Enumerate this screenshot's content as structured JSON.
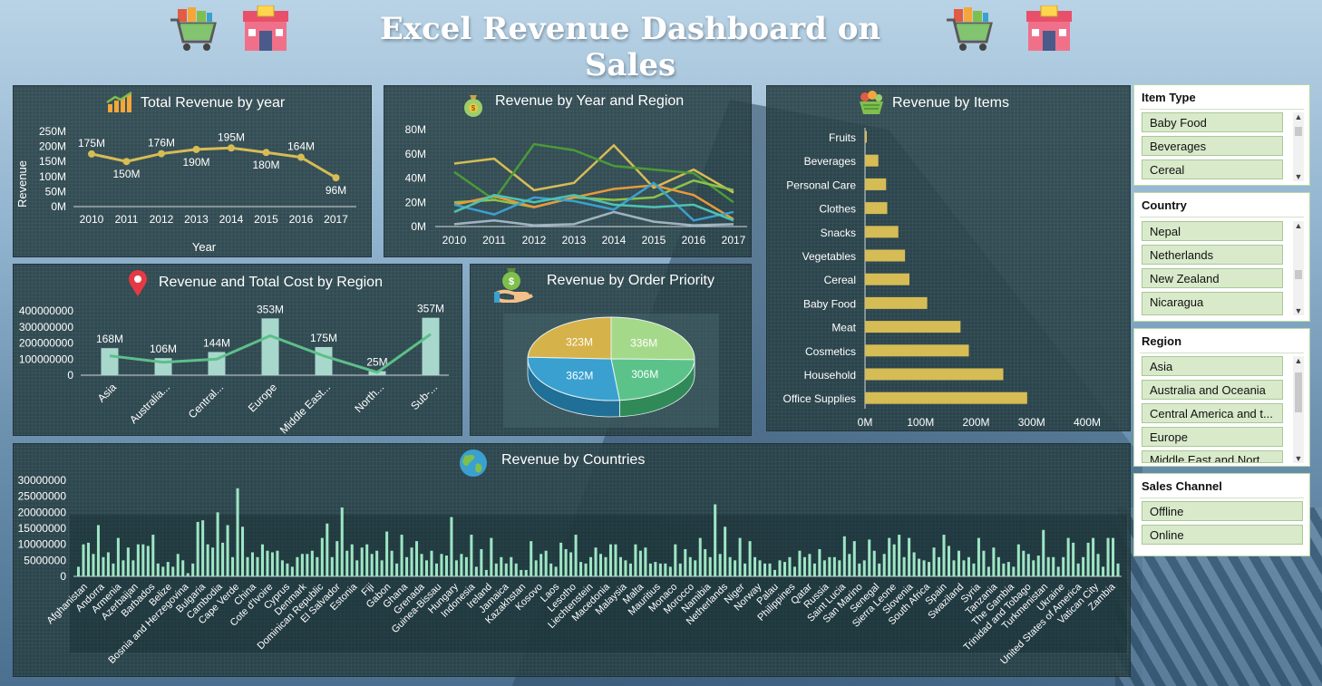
{
  "dashboard": {
    "title": "Excel Revenue Dashboard on Sales"
  },
  "colors": {
    "gold": "#d6bc55",
    "green": "#4caf6a",
    "teal_bar": "#a8d8cc",
    "line_green": "#5dbf8a",
    "country_bar": "#9ee6c4",
    "pie_gold": "#d6b24a",
    "pie_lightgreen": "#a5d98a",
    "pie_green": "#5bc38a",
    "pie_blue": "#3aa0d0"
  },
  "panels": {
    "total_revenue": {
      "title": "Total Revenue by year",
      "icon": "bar-chart-arrow-icon"
    },
    "year_region": {
      "title": "Revenue by Year and Region",
      "icon": "money-bag-icon"
    },
    "items": {
      "title": "Revenue by Items",
      "icon": "grocery-basket-icon"
    },
    "region_cost": {
      "title": "Revenue and Total Cost by Region",
      "icon": "map-pin-icon"
    },
    "priority": {
      "title": "Revenue by Order Priority",
      "icon": "hand-money-icon"
    },
    "countries": {
      "title": "Revenue by Countries",
      "icon": "globe-icon"
    }
  },
  "slicers": {
    "item_type": {
      "title": "Item Type",
      "items": [
        "Baby Food",
        "Beverages",
        "Cereal"
      ]
    },
    "country": {
      "title": "Country",
      "items": [
        "Nepal",
        "Netherlands",
        "New Zealand",
        "Nicaragua"
      ]
    },
    "region": {
      "title": "Region",
      "items": [
        "Asia",
        "Australia and Oceania",
        "Central America and t...",
        "Europe",
        "Middle East and Nort..."
      ]
    },
    "sales_channel": {
      "title": "Sales Channel",
      "items": [
        "Offline",
        "Online"
      ]
    }
  },
  "chart_data": [
    {
      "id": "total_revenue",
      "type": "line",
      "title": "Total Revenue by year",
      "xlabel": "Year",
      "ylabel": "Revenue",
      "categories": [
        "2010",
        "2011",
        "2012",
        "2013",
        "2014",
        "2015",
        "2016",
        "2017"
      ],
      "values": [
        175,
        150,
        176,
        190,
        195,
        180,
        164,
        96
      ],
      "data_labels": [
        "175M",
        "150M",
        "176M",
        "190M",
        "195M",
        "180M",
        "164M",
        "96M"
      ],
      "y_ticks": [
        "0M",
        "50M",
        "100M",
        "150M",
        "200M",
        "250M"
      ],
      "ylim": [
        0,
        250
      ]
    },
    {
      "id": "year_region",
      "type": "line",
      "title": "Revenue by Year and Region",
      "categories": [
        "2010",
        "2011",
        "2012",
        "2013",
        "2014",
        "2015",
        "2016",
        "2017"
      ],
      "y_ticks": [
        "0M",
        "20M",
        "40M",
        "60M",
        "80M"
      ],
      "ylim": [
        0,
        80
      ],
      "series": [
        {
          "color": "#d6bc55",
          "values": [
            52,
            56,
            30,
            36,
            67,
            32,
            47,
            28
          ]
        },
        {
          "color": "#4a9a3a",
          "values": [
            45,
            22,
            68,
            63,
            50,
            47,
            44,
            20
          ]
        },
        {
          "color": "#8cc34a",
          "values": [
            20,
            22,
            16,
            24,
            22,
            24,
            38,
            30
          ]
        },
        {
          "color": "#e89a3a",
          "values": [
            18,
            25,
            16,
            24,
            31,
            34,
            26,
            6
          ]
        },
        {
          "color": "#3aa0d0",
          "values": [
            18,
            10,
            24,
            21,
            14,
            36,
            5,
            12
          ]
        },
        {
          "color": "#4fc3b0",
          "values": [
            12,
            26,
            20,
            26,
            18,
            16,
            18,
            5
          ]
        },
        {
          "color": "#9fb3c0",
          "values": [
            2,
            5,
            1,
            2,
            12,
            4,
            1,
            2
          ]
        }
      ]
    },
    {
      "id": "items",
      "type": "bar",
      "title": "Revenue by Items",
      "orientation": "horizontal",
      "categories": [
        "Fruits",
        "Beverages",
        "Personal Care",
        "Clothes",
        "Snacks",
        "Vegetables",
        "Cereal",
        "Baby Food",
        "Meat",
        "Cosmetics",
        "Household",
        "Office Supplies"
      ],
      "values": [
        3,
        24,
        38,
        40,
        60,
        72,
        80,
        112,
        172,
        187,
        249,
        292
      ],
      "x_ticks": [
        "0M",
        "100M",
        "200M",
        "300M",
        "400M"
      ],
      "xlim": [
        0,
        400
      ]
    },
    {
      "id": "region_cost",
      "type": "bar",
      "title": "Revenue and Total Cost by Region",
      "categories": [
        "Asia",
        "Australia...",
        "Central...",
        "Europe",
        "Middle East...",
        "North...",
        "Sub-..."
      ],
      "series": [
        {
          "name": "Revenue",
          "values": [
            168,
            106,
            144,
            353,
            175,
            25,
            357
          ]
        },
        {
          "name": "Total Cost",
          "values": [
            120,
            80,
            100,
            245,
            120,
            18,
            255
          ]
        }
      ],
      "data_labels": [
        "168M",
        "106M",
        "144M",
        "353M",
        "175M",
        "25M",
        "357M"
      ],
      "y_ticks": [
        "0",
        "100000000",
        "200000000",
        "300000000",
        "400000000"
      ],
      "ylim": [
        0,
        400
      ]
    },
    {
      "id": "priority",
      "type": "pie",
      "title": "Revenue by Order Priority",
      "values": [
        336,
        306,
        362,
        323
      ],
      "data_labels": [
        "336M",
        "306M",
        "362M",
        "323M"
      ]
    },
    {
      "id": "countries",
      "type": "bar",
      "title": "Revenue by Countries",
      "y_ticks": [
        "0",
        "5000000",
        "10000000",
        "15000000",
        "20000000",
        "25000000",
        "30000000"
      ],
      "ylim": [
        0,
        30000000
      ],
      "tick_labels": [
        "Afghanistan",
        "Andorra",
        "Armenia",
        "Azerbaijan",
        "Barbados",
        "Belize",
        "Bosnia and Herzegovina",
        "Bulgaria",
        "Cambodia",
        "Cape Verde",
        "China",
        "Cote d'Ivoire",
        "Cyprus",
        "Denmark",
        "Dominican Republic",
        "El Salvador",
        "Estonia",
        "Fiji",
        "Gabon",
        "Ghana",
        "Grenada",
        "Guinea-Bissau",
        "Hungary",
        "Indonesia",
        "Ireland",
        "Jamaica",
        "Kazakhstan",
        "Kosovo",
        "Laos",
        "Lesotho",
        "Liechtenstein",
        "Macedonia",
        "Malaysia",
        "Malta",
        "Mauritius",
        "Monaco",
        "Morocco",
        "Namibia",
        "Netherlands",
        "Niger",
        "Norway",
        "Palau",
        "Philippines",
        "Qatar",
        "Russia",
        "Saint Lucia",
        "San Marino",
        "Senegal",
        "Sierra Leone",
        "Slovenia",
        "South Africa",
        "Spain",
        "Swaziland",
        "Syria",
        "Tanzania",
        "The Gambia",
        "Trinidad and Tobago",
        "Turkmenistan",
        "Ukraine",
        "United States of America",
        "Vatican City",
        "Zambia"
      ],
      "values": [
        3,
        10,
        10.5,
        7,
        16,
        6,
        7.5,
        4,
        12,
        5,
        9,
        5,
        10,
        10,
        9.5,
        13,
        4,
        3,
        4.5,
        3,
        7,
        5,
        1,
        4,
        17,
        17.5,
        10,
        9,
        20,
        10.5,
        16,
        6,
        27.5,
        15.5,
        6,
        7.5,
        6,
        10,
        8,
        7.5,
        8,
        5,
        4,
        3,
        6,
        7,
        7,
        8,
        6,
        12,
        16.5,
        6,
        11,
        21.5,
        8,
        10,
        5,
        9,
        10,
        7,
        8,
        5,
        14,
        8,
        4,
        13,
        6,
        9,
        11,
        7,
        5,
        8,
        4,
        7,
        6.5,
        18.5,
        5,
        7,
        6,
        13,
        3,
        8.5,
        2,
        12,
        4,
        6,
        4,
        6,
        4,
        2,
        2,
        11,
        5,
        7,
        8,
        4,
        3,
        10.5,
        8.5,
        7.5,
        13,
        4.5,
        4,
        6,
        9,
        7,
        6,
        10,
        10,
        6,
        5,
        4,
        10,
        8,
        9,
        4,
        4.5,
        4,
        4,
        3,
        10,
        4,
        8.5,
        6,
        5,
        12,
        8.5,
        6,
        22.5,
        7,
        15.5,
        6,
        5,
        12,
        4,
        11,
        6,
        5,
        4,
        4,
        2,
        5,
        4.5,
        6,
        3,
        8,
        6,
        7,
        4,
        8.5,
        5,
        6,
        6,
        5,
        12.5,
        7,
        11,
        4,
        5,
        11.5,
        8,
        4,
        7,
        12,
        10,
        13,
        6,
        12,
        7.5,
        5.5,
        5,
        4.5,
        9,
        6,
        13,
        9.5,
        5,
        8,
        5,
        6,
        4,
        12,
        8,
        3,
        9,
        6,
        4,
        4.5,
        3,
        10,
        8,
        7,
        5,
        6.5,
        14.5,
        6,
        6,
        3,
        6,
        12,
        10.5,
        4,
        6,
        10.5,
        12,
        7,
        3,
        12,
        12,
        4
      ]
    }
  ]
}
